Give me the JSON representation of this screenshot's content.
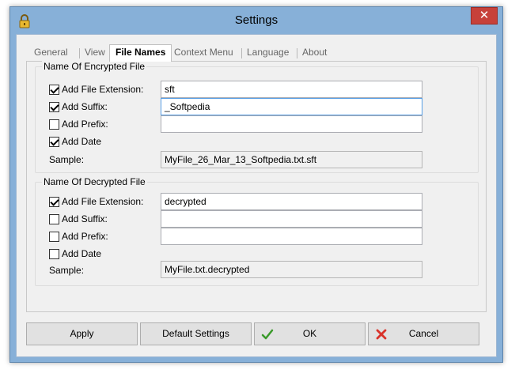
{
  "window": {
    "title": "Settings"
  },
  "tabs": [
    {
      "label": "General"
    },
    {
      "label": "View"
    },
    {
      "label": "File Names",
      "active": true
    },
    {
      "label": "Context Menu"
    },
    {
      "label": "Language"
    },
    {
      "label": "About"
    }
  ],
  "encrypted": {
    "title": "Name Of Encrypted File",
    "ext_label": "Add File Extension:",
    "ext_checked": true,
    "ext_value": "sft",
    "suffix_label": "Add Suffix:",
    "suffix_checked": true,
    "suffix_value": "_Softpedia",
    "prefix_label": "Add Prefix:",
    "prefix_checked": false,
    "prefix_value": "",
    "date_label": "Add Date",
    "date_checked": true,
    "sample_label": "Sample:",
    "sample_value": "MyFile_26_Mar_13_Softpedia.txt.sft"
  },
  "decrypted": {
    "title": "Name Of Decrypted File",
    "ext_label": "Add File Extension:",
    "ext_checked": true,
    "ext_value": "decrypted",
    "suffix_label": "Add Suffix:",
    "suffix_checked": false,
    "suffix_value": "",
    "prefix_label": "Add Prefix:",
    "prefix_checked": false,
    "prefix_value": "",
    "date_label": "Add Date",
    "date_checked": false,
    "sample_label": "Sample:",
    "sample_value": "MyFile.txt.decrypted"
  },
  "buttons": {
    "apply": "Apply",
    "default": "Default Settings",
    "ok": "OK",
    "cancel": "Cancel"
  },
  "colors": {
    "ok_icon": "#3a9a2a",
    "cancel_icon": "#d9332a",
    "close_button": "#c7413a"
  }
}
